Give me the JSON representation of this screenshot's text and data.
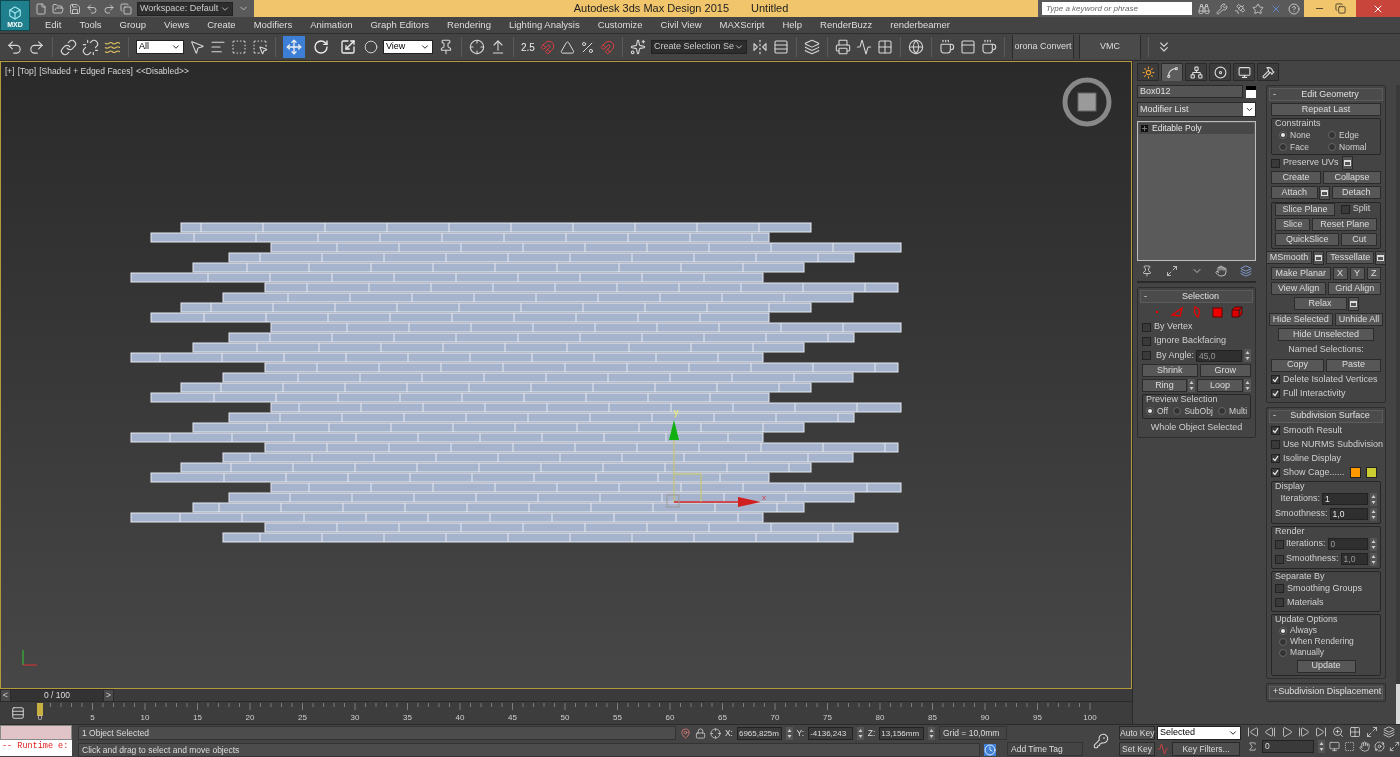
{
  "title_bar": {
    "logo": "MXD",
    "workspace": "Workspace: Default",
    "title": "Autodesk 3ds Max Design 2015",
    "document": "Untitled",
    "search": {
      "placeholder": "Type a keyword or phrase"
    }
  },
  "menu": [
    "Edit",
    "Tools",
    "Group",
    "Views",
    "Create",
    "Modifiers",
    "Animation",
    "Graph Editors",
    "Rendering",
    "Lighting Analysis",
    "Customize",
    "Civil View",
    "MAXScript",
    "Help",
    "RenderBuzz",
    "renderbeamer"
  ],
  "toolbar": {
    "selection_filter": "All",
    "transform_tools": [
      {
        "selected": true
      },
      {
        "selected": false
      },
      {
        "selected": false
      }
    ],
    "reference_coordinate": "View",
    "snap_value": "2.5",
    "named_selection": "Create Selection Se",
    "text_buttons": [
      "orona Convert",
      "VMC"
    ]
  },
  "viewport": {
    "labels": [
      "[+]",
      "[Top]",
      "[Shaded + Edged Faces]",
      "<<Disabled>>"
    ],
    "active": true,
    "gizmo_labels": {
      "x": "x",
      "y": "y"
    }
  },
  "command_panel": {
    "tabs": [
      {
        "selected": false
      },
      {
        "selected": true
      },
      {
        "selected": false
      },
      {
        "selected": false
      },
      {
        "selected": false
      },
      {
        "selected": false
      }
    ],
    "object_name": "Box012",
    "modifier_list": "Modifier List",
    "stack": [
      {
        "label": "Editable Poly",
        "expanded": false
      }
    ],
    "left_rollouts": [
      {
        "toggle": "-",
        "title": "Selection",
        "items": [
          {
            "kind": "subobject_icons",
            "levels": [
              {
                "selected": false
              },
              {
                "selected": false
              },
              {
                "selected": false
              },
              {
                "selected": false
              },
              {
                "selected": false
              }
            ]
          },
          {
            "kind": "check",
            "label": "By Vertex",
            "checked": false
          },
          {
            "kind": "check",
            "label": "Ignore Backfacing",
            "checked": false
          },
          {
            "kind": "spinner",
            "label": "By Angle:",
            "value": "45,0",
            "checked": false,
            "disabled": true
          },
          {
            "kind": "row",
            "items": [
              {
                "kind": "btn",
                "label": "Shrink"
              },
              {
                "kind": "btn",
                "label": "Grow"
              }
            ]
          },
          {
            "kind": "row",
            "items": [
              {
                "kind": "btn",
                "label": "Ring",
                "spinner": true
              },
              {
                "kind": "btn",
                "label": "Loop",
                "spinner": true
              }
            ]
          },
          {
            "kind": "group",
            "title": "Preview Selection",
            "items": [
              {
                "kind": "radios_row",
                "options": [
                  {
                    "label": "Off",
                    "selected": true
                  },
                  {
                    "label": "SubObj",
                    "selected": false
                  },
                  {
                    "label": "Multi",
                    "selected": false
                  }
                ]
              }
            ]
          },
          {
            "kind": "text",
            "text": "Whole Object Selected"
          }
        ]
      }
    ],
    "right_rollouts": [
      {
        "toggle": "-",
        "title": "Edit Geometry",
        "items": [
          {
            "kind": "button",
            "label": "Repeat Last"
          },
          {
            "kind": "group",
            "title": "Constraints",
            "items": [
              {
                "kind": "radios_grid",
                "options": [
                  {
                    "label": "None",
                    "selected": true
                  },
                  {
                    "label": "Edge",
                    "selected": false
                  },
                  {
                    "label": "Face",
                    "selected": false
                  },
                  {
                    "label": "Normal",
                    "selected": false
                  }
                ]
              }
            ]
          },
          {
            "kind": "check",
            "label": "Preserve UVs",
            "checked": false,
            "options": true
          },
          {
            "kind": "row",
            "items": [
              {
                "kind": "btn",
                "label": "Create"
              },
              {
                "kind": "btn",
                "label": "Collapse"
              }
            ]
          },
          {
            "kind": "row",
            "items": [
              {
                "kind": "btn",
                "label": "Attach",
                "options": true
              },
              {
                "kind": "btn",
                "label": "Detach"
              }
            ]
          },
          {
            "kind": "group",
            "items": [
              {
                "kind": "row",
                "items": [
                  {
                    "kind": "btn",
                    "label": "Slice Plane"
                  },
                  {
                    "kind": "check",
                    "label": "Split",
                    "checked": false
                  }
                ]
              },
              {
                "kind": "row",
                "items": [
                  {
                    "kind": "btn",
                    "label": "Slice"
                  },
                  {
                    "kind": "btn",
                    "label": "Reset Plane"
                  }
                ]
              },
              {
                "kind": "row",
                "items": [
                  {
                    "kind": "btn",
                    "label": "QuickSlice"
                  },
                  {
                    "kind": "btn",
                    "label": "Cut"
                  }
                ]
              }
            ]
          },
          {
            "kind": "row",
            "items": [
              {
                "kind": "btn",
                "label": "MSmooth",
                "options": true
              },
              {
                "kind": "btn",
                "label": "Tessellate",
                "options": true
              }
            ]
          },
          {
            "kind": "row",
            "items": [
              {
                "kind": "btn",
                "label": "Make Planar"
              },
              {
                "kind": "btn",
                "label": "X"
              },
              {
                "kind": "btn",
                "label": "Y"
              },
              {
                "kind": "btn",
                "label": "Z"
              }
            ]
          },
          {
            "kind": "row",
            "items": [
              {
                "kind": "btn",
                "label": "View Align"
              },
              {
                "kind": "btn",
                "label": "Grid Align"
              }
            ]
          },
          {
            "kind": "row",
            "items": [
              {
                "kind": "btn",
                "label": "Relax",
                "options": true
              }
            ]
          },
          {
            "kind": "row",
            "items": [
              {
                "kind": "btn",
                "label": "Hide Selected"
              },
              {
                "kind": "btn",
                "label": "Unhide All"
              }
            ]
          },
          {
            "kind": "row",
            "items": [
              {
                "kind": "btn",
                "label": "Hide Unselected"
              }
            ]
          },
          {
            "kind": "text",
            "text": "Named Selections:"
          },
          {
            "kind": "row",
            "items": [
              {
                "kind": "btn",
                "label": "Copy"
              },
              {
                "kind": "btn",
                "label": "Paste"
              }
            ]
          },
          {
            "kind": "check",
            "label": "Delete Isolated Vertices",
            "checked": true
          },
          {
            "kind": "check",
            "label": "Full Interactivity",
            "checked": true
          }
        ]
      },
      {
        "toggle": "-",
        "title": "Subdivision Surface",
        "items": [
          {
            "kind": "check",
            "label": "Smooth Result",
            "checked": true
          },
          {
            "kind": "check",
            "label": "Use NURMS Subdivision",
            "checked": false
          },
          {
            "kind": "check",
            "label": "Isoline Display",
            "checked": true
          },
          {
            "kind": "check",
            "label": "Show Cage......",
            "checked": true,
            "swatches": [
              {
                "color": "#ff9900"
              },
              {
                "color": "#cccc33"
              }
            ]
          },
          {
            "kind": "group",
            "title": "Display",
            "items": [
              {
                "kind": "spinner",
                "label": "Iterations:",
                "value": "1",
                "disabled": false
              },
              {
                "kind": "spinner",
                "label": "Smoothness:",
                "value": "1,0",
                "disabled": false
              }
            ]
          },
          {
            "kind": "group",
            "title": "Render",
            "items": [
              {
                "kind": "spinner",
                "label": "Iterations:",
                "value": "0",
                "checked": false,
                "disabled": true
              },
              {
                "kind": "spinner",
                "label": "Smoothness:",
                "value": "1,0",
                "checked": false,
                "disabled": true
              }
            ]
          },
          {
            "kind": "group",
            "title": "Separate By",
            "items": [
              {
                "kind": "check",
                "label": "Smoothing Groups",
                "checked": false
              },
              {
                "kind": "check",
                "label": "Materials",
                "checked": false
              }
            ]
          },
          {
            "kind": "group",
            "title": "Update Options",
            "items": [
              {
                "kind": "radios_column",
                "options": [
                  {
                    "label": "Always",
                    "selected": true
                  },
                  {
                    "label": "When Rendering",
                    "selected": false
                  },
                  {
                    "label": "Manually",
                    "selected": false
                  }
                ]
              },
              {
                "kind": "row",
                "items": [
                  {
                    "kind": "btn",
                    "label": "Update"
                  }
                ]
              }
            ]
          }
        ]
      },
      {
        "toggle": "+",
        "title": "Subdivision Displacement"
      }
    ]
  },
  "time_slider": {
    "label": "0 / 100",
    "prev": "<",
    "next": ">",
    "level": 0
  },
  "track_bar": {
    "ticks": [
      "0",
      "5",
      "10",
      "15",
      "20",
      "25",
      "30",
      "35",
      "40",
      "45",
      "50",
      "55",
      "60",
      "65",
      "70",
      "75",
      "80",
      "85",
      "90",
      "95",
      "100"
    ]
  },
  "status_bar": {
    "listener_output": "-- Runtime e:",
    "status": "1 Object Selected",
    "prompt": "Click and drag to select and move objects",
    "coordinates": [
      {
        "label": "X:",
        "value": "6965,825m"
      },
      {
        "label": "Y:",
        "value": "-4136,243"
      },
      {
        "label": "Z:",
        "value": "13,156mm"
      }
    ],
    "grid": "Grid = 10,0mm",
    "time_tag": "Add Time Tag",
    "auto_key": "Auto Key",
    "set_key": "Set Key",
    "key_mode": "Selected",
    "key_filters": "Key Filters...",
    "frame": "0"
  }
}
